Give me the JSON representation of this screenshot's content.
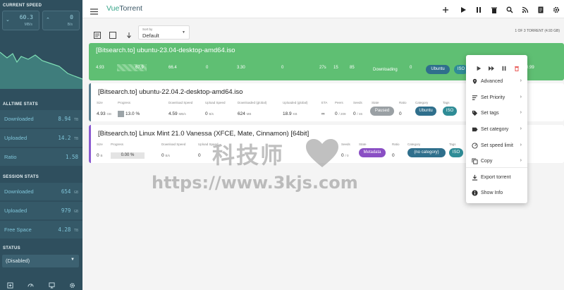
{
  "sidebar": {
    "current_speed_title": "CURRENT SPEED",
    "download": {
      "value": "60.3",
      "unit": "MB/s"
    },
    "upload": {
      "value": "0",
      "unit": "B/s"
    },
    "alltime_title": "ALLTIME STATS",
    "alltime": [
      {
        "label": "Downloaded",
        "value": "8.94",
        "unit": "TB"
      },
      {
        "label": "Uploaded",
        "value": "14.2",
        "unit": "TB"
      },
      {
        "label": "Ratio",
        "value": "1.58",
        "unit": ""
      }
    ],
    "session_title": "SESSION STATS",
    "session": [
      {
        "label": "Downloaded",
        "value": "654",
        "unit": "GB"
      },
      {
        "label": "Uploaded",
        "value": "979",
        "unit": "GB"
      },
      {
        "label": "Free Space",
        "value": "4.28",
        "unit": "TB"
      }
    ],
    "status_title": "STATUS",
    "status_value": "(Disabled)"
  },
  "header": {
    "brand_a": "Vue",
    "brand_b": "Torrent"
  },
  "toolbar": {
    "sort_label": "Sort by",
    "sort_value": "Default",
    "torrent_count": "1 OF 3 TORRENT (4.93 GB)"
  },
  "torrents": [
    {
      "name": "[Bitsearch.to] ubuntu-23.04-desktop-amd64.iso",
      "cells": [
        "4.93",
        "67.9",
        "66.4",
        "0",
        "3.30",
        "0",
        "27s",
        "15",
        "85",
        "Downloading",
        "0"
      ],
      "category": "Ubuntu",
      "tag": "ISO",
      "extra": "0.99"
    },
    {
      "name": "[Bitsearch.to] ubuntu-22.04.2-desktop-amd64.iso",
      "labels": {
        "size": "Size",
        "progress": "Progress",
        "dl": "Download Speed",
        "ul": "Upload Speed",
        "dlg": "Downloaded (global)",
        "ulg": "Uploaded (global)",
        "eta": "ETA",
        "peers": "Peers",
        "seeds": "Seeds",
        "state": "State",
        "ratio": "Ratio",
        "category": "Category",
        "tags": "Tags"
      },
      "size": "4.93",
      "size_unit": "GB",
      "progress": "13.0 %",
      "dl": "4.59",
      "dl_unit": "MB/s",
      "ul": "0",
      "ul_unit": "B/s",
      "dlg": "624",
      "dlg_unit": "MB",
      "ulg": "18.9",
      "ulg_unit": "KB",
      "eta": "∞",
      "peers": "0",
      "peers_total": "/ 209",
      "seeds": "0",
      "seeds_total": "/ 46",
      "state": "Paused",
      "ratio": "0",
      "category": "Ubuntu",
      "tag": "ISO"
    },
    {
      "name": "[Bitsearch.to] Linux Mint 21.0 Vanessa (XFCE, Mate, Cinnamon) [64bit]",
      "size": "0",
      "size_unit": "B",
      "progress": "0.00 %",
      "dl": "0",
      "dl_unit": "B/s",
      "ul": "0",
      "seeds": "0",
      "seeds_total": "/ 0",
      "state": "Metadata",
      "ratio": "0",
      "category": "(no category)",
      "tag": "ISO"
    }
  ],
  "context_menu": {
    "items": [
      {
        "label": "Advanced",
        "icon": "pin-icon",
        "chevron": "›"
      },
      {
        "label": "Set Priority",
        "icon": "priority-icon",
        "chevron": "›"
      },
      {
        "label": "Set tags",
        "icon": "tag-icon",
        "chevron": "›"
      },
      {
        "label": "Set category",
        "icon": "label-icon",
        "chevron": "›"
      },
      {
        "label": "Set speed limit",
        "icon": "speedometer-icon",
        "chevron": "›"
      },
      {
        "label": "Copy",
        "icon": "copy-icon",
        "chevron": "›"
      },
      {
        "label": "Export torrent",
        "icon": "download-icon",
        "chevron": ""
      },
      {
        "label": "Show Info",
        "icon": "info-icon",
        "chevron": ""
      }
    ]
  },
  "watermark": {
    "line1": "科技师",
    "line2": "https://www.3kjs.com"
  }
}
